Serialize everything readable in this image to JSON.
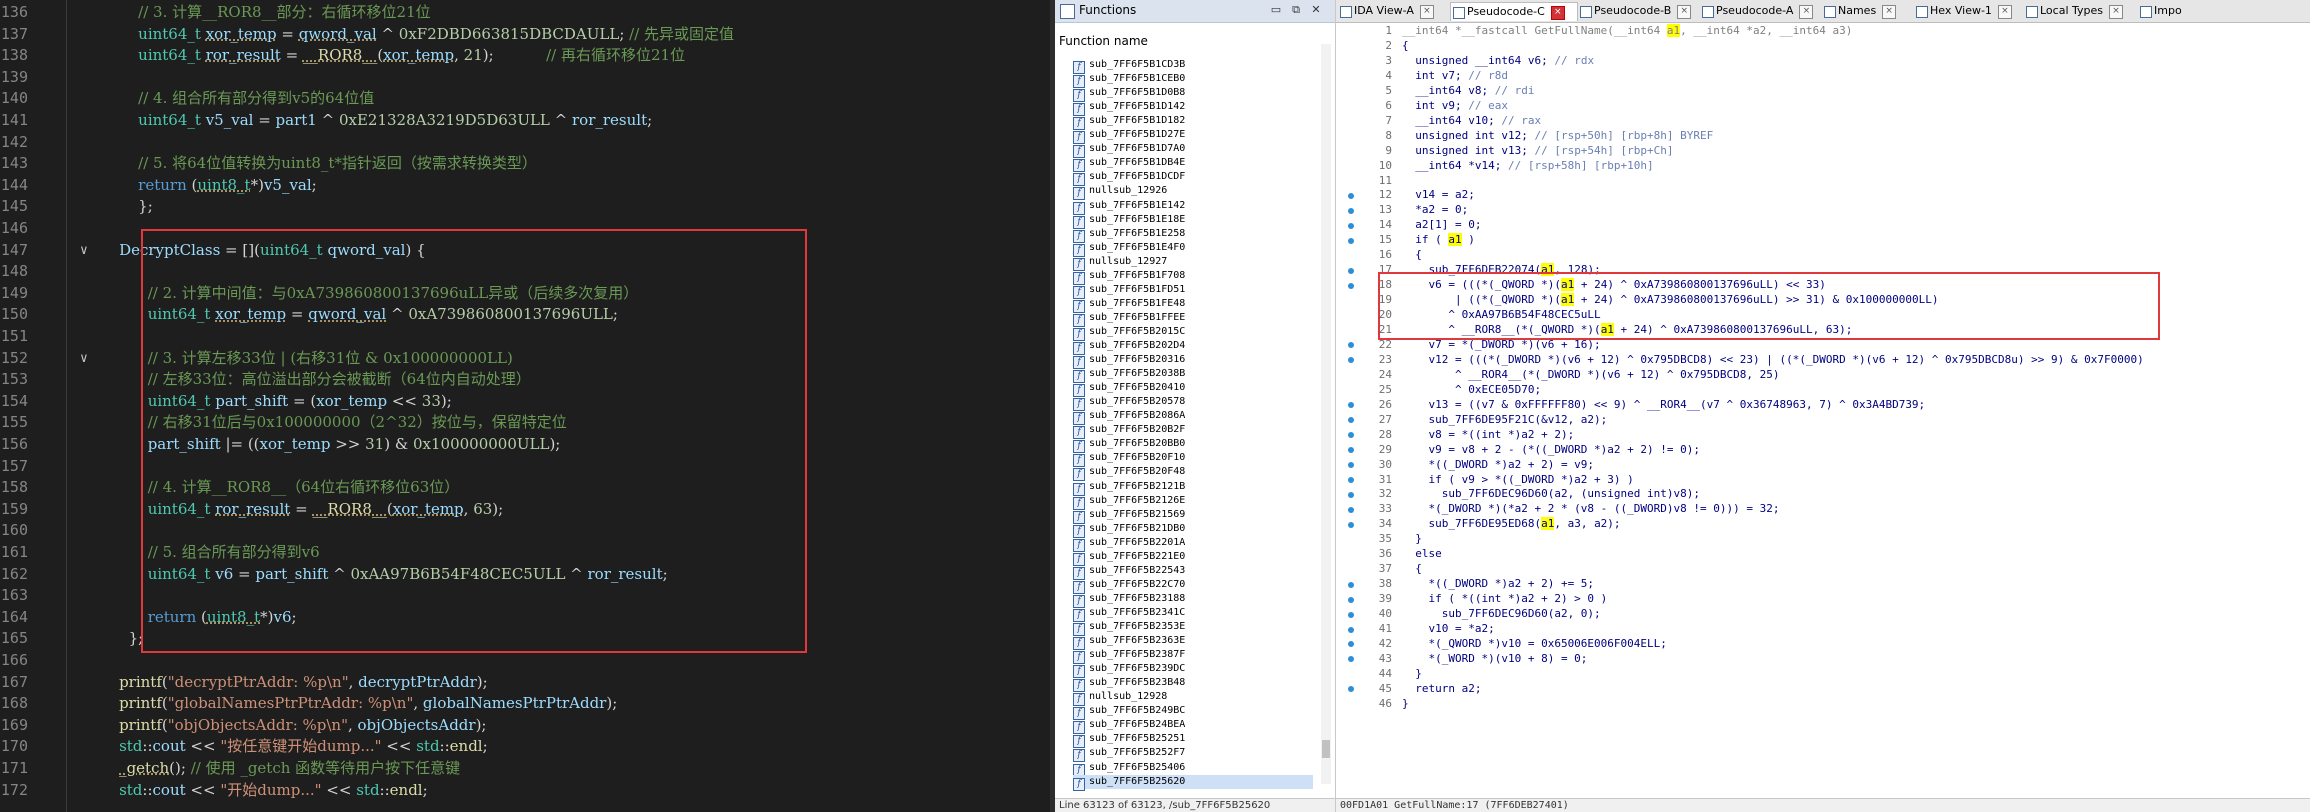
{
  "editor": {
    "lines": [
      {
        "n": "136",
        "html": "        <span class='cmt'>// 3. 计算__ROR8__部分：右循环移位21位</span>"
      },
      {
        "n": "137",
        "html": "        <span class='ty'>uint64_t</span> <span class='id sq'>xor_temp</span> = <span class='id sq'>qword_val</span> ^ <span class='num'>0xF2DBD663815DBCDAULL</span>; <span class='cmt'>// 先异或固定值</span>"
      },
      {
        "n": "138",
        "html": "        <span class='ty'>uint64_t</span> <span class='id sq'>ror_result</span> = <span class='fn sq'>__ROR8__</span>(<span class='id sq'>xor_temp</span>, <span class='num'>21</span>);           <span class='cmt'>// 再右循环移位21位</span>"
      },
      {
        "n": "139",
        "html": ""
      },
      {
        "n": "140",
        "html": "        <span class='cmt'>// 4. 组合所有部分得到v5的64位值</span>"
      },
      {
        "n": "141",
        "html": "        <span class='ty'>uint64_t</span> <span class='id'>v5_val</span> = <span class='id'>part1</span> ^ <span class='num'>0xE21328A3219D5D63ULL</span> ^ <span class='id'>ror_result</span>;"
      },
      {
        "n": "142",
        "html": ""
      },
      {
        "n": "143",
        "html": "        <span class='cmt'>// 5. 将64位值转换为uint8_t*指针返回（按需求转换类型）</span>"
      },
      {
        "n": "144",
        "html": "        <span class='kw'>return</span> (<span class='ty sq'>uint8_t</span>*)<span class='id'>v5_val</span>;"
      },
      {
        "n": "145",
        "html": "        };"
      },
      {
        "n": "146",
        "html": ""
      },
      {
        "n": "147",
        "html": "    <span class='id'>DecryptClass</span> = [](<span class='ty'>uint64_t</span> <span class='id'>qword_val</span>) {"
      },
      {
        "n": "148",
        "html": ""
      },
      {
        "n": "149",
        "html": "          <span class='cmt'>// 2. 计算中间值：与0xA739860800137696uLL异或（后续多次复用）</span>"
      },
      {
        "n": "150",
        "html": "          <span class='ty'>uint64_t</span> <span class='id sq'>xor_temp</span> = <span class='id sq'>qword_val</span> ^ <span class='num'>0xA739860800137696ULL</span>;"
      },
      {
        "n": "151",
        "html": ""
      },
      {
        "n": "152",
        "html": "          <span class='cmt'>// 3. 计算左移33位 | (右移31位 &amp; 0x100000000LL)</span>"
      },
      {
        "n": "153",
        "html": "          <span class='cmt'>// 左移33位：高位溢出部分会被截断（64位内自动处理）</span>"
      },
      {
        "n": "154",
        "html": "          <span class='ty'>uint64_t</span> <span class='id'>part_shift</span> = (<span class='id'>xor_temp</span> &lt;&lt; <span class='num'>33</span>);"
      },
      {
        "n": "155",
        "html": "          <span class='cmt'>// 右移31位后与0x100000000（2^32）按位与，保留特定位</span>"
      },
      {
        "n": "156",
        "html": "          <span class='id'>part_shift</span> |= ((<span class='id'>xor_temp</span> &gt;&gt; <span class='num'>31</span>) &amp; <span class='num'>0x100000000ULL</span>);"
      },
      {
        "n": "157",
        "html": ""
      },
      {
        "n": "158",
        "html": "          <span class='cmt'>// 4. 计算__ROR8__（64位右循环移位63位）</span>"
      },
      {
        "n": "159",
        "html": "          <span class='ty'>uint64_t</span> <span class='id sq'>ror_result</span> = <span class='fn sq'>__ROR8__</span>(<span class='id sq'>xor_temp</span>, <span class='num'>63</span>);"
      },
      {
        "n": "160",
        "html": ""
      },
      {
        "n": "161",
        "html": "          <span class='cmt'>// 5. 组合所有部分得到v6</span>"
      },
      {
        "n": "162",
        "html": "          <span class='ty'>uint64_t</span> <span class='id'>v6</span> = <span class='id'>part_shift</span> ^ <span class='num'>0xAA97B6B54F48CEC5ULL</span> ^ <span class='id'>ror_result</span>;"
      },
      {
        "n": "163",
        "html": ""
      },
      {
        "n": "164",
        "html": "          <span class='kw'>return</span> (<span class='ty sq'>uint8_t</span>*)<span class='id'>v6</span>;"
      },
      {
        "n": "165",
        "html": "      };"
      },
      {
        "n": "166",
        "html": ""
      },
      {
        "n": "167",
        "html": "    <span class='fn'>printf</span>(<span class='str'>\"decryptPtrAddr: %p\\n\"</span>, <span class='id'>decryptPtrAddr</span>);"
      },
      {
        "n": "168",
        "html": "    <span class='fn'>printf</span>(<span class='str'>\"globalNamesPtrPtrAddr: %p\\n\"</span>, <span class='id'>globalNamesPtrPtrAddr</span>);"
      },
      {
        "n": "169",
        "html": "    <span class='fn'>printf</span>(<span class='str'>\"objObjectsAddr: %p\\n\"</span>, <span class='id'>objObjectsAddr</span>);"
      },
      {
        "n": "170",
        "html": "    <span class='ty'>std</span>::<span class='id'>cout</span> &lt;&lt; <span class='str'>\"按任意键开始dump...\"</span> &lt;&lt; <span class='ty'>std</span>::<span class='fn'>endl</span>;"
      },
      {
        "n": "171",
        "html": "    <span class='fn sq'>_getch</span>(); <span class='cmt'>// 使用 _getch 函数等待用户按下任意键</span>"
      },
      {
        "n": "172",
        "html": "    <span class='ty'>std</span>::<span class='id'>cout</span> &lt;&lt; <span class='str'>\"开始dump...\"</span> &lt;&lt; <span class='ty'>std</span>::<span class='fn'>endl</span>;"
      }
    ]
  },
  "functions": {
    "title": "Functions",
    "column_header": "Function name",
    "items": [
      "sub_7FF6F5B1CD3B",
      "sub_7FF6F5B1CEB0",
      "sub_7FF6F5B1D0B8",
      "sub_7FF6F5B1D142",
      "sub_7FF6F5B1D182",
      "sub_7FF6F5B1D27E",
      "sub_7FF6F5B1D7A0",
      "sub_7FF6F5B1DB4E",
      "sub_7FF6F5B1DCDF",
      "nullsub_12926",
      "sub_7FF6F5B1E142",
      "sub_7FF6F5B1E18E",
      "sub_7FF6F5B1E258",
      "sub_7FF6F5B1E4F0",
      "nullsub_12927",
      "sub_7FF6F5B1F708",
      "sub_7FF6F5B1FD51",
      "sub_7FF6F5B1FE48",
      "sub_7FF6F5B1FFEE",
      "sub_7FF6F5B2015C",
      "sub_7FF6F5B202D4",
      "sub_7FF6F5B20316",
      "sub_7FF6F5B2038B",
      "sub_7FF6F5B20410",
      "sub_7FF6F5B20578",
      "sub_7FF6F5B2086A",
      "sub_7FF6F5B20B2F",
      "sub_7FF6F5B20BB0",
      "sub_7FF6F5B20F10",
      "sub_7FF6F5B20F48",
      "sub_7FF6F5B2121B",
      "sub_7FF6F5B2126E",
      "sub_7FF6F5B21569",
      "sub_7FF6F5B21DB0",
      "sub_7FF6F5B2201A",
      "sub_7FF6F5B221E0",
      "sub_7FF6F5B22543",
      "sub_7FF6F5B22C70",
      "sub_7FF6F5B23188",
      "sub_7FF6F5B2341C",
      "sub_7FF6F5B2353E",
      "sub_7FF6F5B2363E",
      "sub_7FF6F5B2387F",
      "sub_7FF6F5B239DC",
      "sub_7FF6F5B23B48",
      "nullsub_12928",
      "sub_7FF6F5B249BC",
      "sub_7FF6F5B24BEA",
      "sub_7FF6F5B25251",
      "sub_7FF6F5B252F7",
      "sub_7FF6F5B25406",
      "sub_7FF6F5B25620"
    ],
    "status": "Line 63123 of 63123, /sub_7FF6F5B25620"
  },
  "pseudo": {
    "tabs": [
      {
        "label": "IDA View-A",
        "close": "×",
        "active": false
      },
      {
        "label": "Pseudocode-C",
        "close": "×",
        "active": true
      },
      {
        "label": "Pseudocode-B",
        "close": "×",
        "active": false
      },
      {
        "label": "Pseudocode-A",
        "close": "×",
        "active": false
      },
      {
        "label": "Names",
        "close": "×",
        "active": false
      },
      {
        "label": "Hex View-1",
        "close": "×",
        "active": false
      },
      {
        "label": "Local Types",
        "close": "×",
        "active": false
      },
      {
        "label": "Impo",
        "close": "",
        "active": false
      }
    ],
    "lines": [
      {
        "n": "1",
        "dot": false,
        "html": "<span class='pgr'>__int64 *__fastcall GetFullName(__int64 <span class='hl'>a1</span>, __int64 *a2, __int64 a3)</span>"
      },
      {
        "n": "2",
        "dot": false,
        "html": "{"
      },
      {
        "n": "3",
        "dot": false,
        "html": "  unsigned __int64 v6; <span class='pcm'>// rdx</span>"
      },
      {
        "n": "4",
        "dot": false,
        "html": "  int v7; <span class='pcm'>// r8d</span>"
      },
      {
        "n": "5",
        "dot": false,
        "html": "  __int64 v8; <span class='pcm'>// rdi</span>"
      },
      {
        "n": "6",
        "dot": false,
        "html": "  int v9; <span class='pcm'>// eax</span>"
      },
      {
        "n": "7",
        "dot": false,
        "html": "  __int64 v10; <span class='pcm'>// rax</span>"
      },
      {
        "n": "8",
        "dot": false,
        "html": "  unsigned int v12; <span class='pcm'>// [rsp+50h] [rbp+8h] BYREF</span>"
      },
      {
        "n": "9",
        "dot": false,
        "html": "  unsigned int v13; <span class='pcm'>// [rsp+54h] [rbp+Ch]</span>"
      },
      {
        "n": "10",
        "dot": false,
        "html": "  __int64 *v14; <span class='pcm'>// [rsp+58h] [rbp+10h]</span>"
      },
      {
        "n": "11",
        "dot": false,
        "html": ""
      },
      {
        "n": "12",
        "dot": true,
        "html": "  v14 = a2;"
      },
      {
        "n": "13",
        "dot": true,
        "html": "  *a2 = 0;"
      },
      {
        "n": "14",
        "dot": true,
        "html": "  a2[1] = 0;"
      },
      {
        "n": "15",
        "dot": true,
        "html": "  if ( <span class='hl'>a1</span> )"
      },
      {
        "n": "16",
        "dot": false,
        "html": "  {"
      },
      {
        "n": "17",
        "dot": true,
        "html": "    sub_7FF6DEB22074(<span class='hl'>a1</span>, 128);"
      },
      {
        "n": "18",
        "dot": true,
        "html": "    v6 = (((*(_QWORD *)(<span class='hl'>a1</span> + 24) ^ 0xA739860800137696uLL) &lt;&lt; 33)"
      },
      {
        "n": "19",
        "dot": false,
        "html": "        | ((*(_QWORD *)(<span class='hl'>a1</span> + 24) ^ 0xA739860800137696uLL) &gt;&gt; 31) &amp; 0x100000000LL)"
      },
      {
        "n": "20",
        "dot": false,
        "html": "       ^ 0xAA97B6B54F48CEC5uLL"
      },
      {
        "n": "21",
        "dot": false,
        "html": "       ^ __ROR8__(*(_QWORD *)(<span class='hl'>a1</span> + 24) ^ 0xA739860800137696uLL, 63);"
      },
      {
        "n": "22",
        "dot": true,
        "html": "    v7 = *(_DWORD *)(v6 + 16);"
      },
      {
        "n": "23",
        "dot": true,
        "html": "    v12 = (((*(_DWORD *)(v6 + 12) ^ 0x795DBCD8) &lt;&lt; 23) | ((*(_DWORD *)(v6 + 12) ^ 0x795DBCD8u) &gt;&gt; 9) &amp; 0x7F0000)"
      },
      {
        "n": "24",
        "dot": false,
        "html": "        ^ __ROR4__(*(_DWORD *)(v6 + 12) ^ 0x795DBCD8, 25)"
      },
      {
        "n": "25",
        "dot": false,
        "html": "        ^ 0xECE05D70;"
      },
      {
        "n": "26",
        "dot": true,
        "html": "    v13 = ((v7 &amp; 0xFFFFFF80) &lt;&lt; 9) ^ __ROR4__(v7 ^ 0x36748963, 7) ^ 0x3A4BD739;"
      },
      {
        "n": "27",
        "dot": true,
        "html": "    sub_7FF6DE95F21C(&amp;v12, a2);"
      },
      {
        "n": "28",
        "dot": true,
        "html": "    v8 = *((int *)a2 + 2);"
      },
      {
        "n": "29",
        "dot": true,
        "html": "    v9 = v8 + 2 - (*((_DWORD *)a2 + 2) != 0);"
      },
      {
        "n": "30",
        "dot": true,
        "html": "    *((_DWORD *)a2 + 2) = v9;"
      },
      {
        "n": "31",
        "dot": true,
        "html": "    if ( v9 &gt; *((_DWORD *)a2 + 3) )"
      },
      {
        "n": "32",
        "dot": true,
        "html": "      sub_7FF6DEC96D60(a2, (unsigned int)v8);"
      },
      {
        "n": "33",
        "dot": true,
        "html": "    *(_DWORD *)(*a2 + 2 * (v8 - ((_DWORD)v8 != 0))) = 32;"
      },
      {
        "n": "34",
        "dot": true,
        "html": "    sub_7FF6DE95ED68(<span class='hl'>a1</span>, a3, a2);"
      },
      {
        "n": "35",
        "dot": false,
        "html": "  }"
      },
      {
        "n": "36",
        "dot": false,
        "html": "  else"
      },
      {
        "n": "37",
        "dot": false,
        "html": "  {"
      },
      {
        "n": "38",
        "dot": true,
        "html": "    *((_DWORD *)a2 + 2) += 5;"
      },
      {
        "n": "39",
        "dot": true,
        "html": "    if ( *((int *)a2 + 2) &gt; 0 )"
      },
      {
        "n": "40",
        "dot": true,
        "html": "      sub_7FF6DEC96D60(a2, 0);"
      },
      {
        "n": "41",
        "dot": true,
        "html": "    v10 = *a2;"
      },
      {
        "n": "42",
        "dot": true,
        "html": "    *(_QWORD *)v10 = 0x65006E006F004ELL;"
      },
      {
        "n": "43",
        "dot": true,
        "html": "    *(_WORD *)(v10 + 8) = 0;"
      },
      {
        "n": "44",
        "dot": false,
        "html": "  }"
      },
      {
        "n": "45",
        "dot": true,
        "html": "  return a2;"
      },
      {
        "n": "46",
        "dot": false,
        "html": "}"
      }
    ],
    "status": "00FD1A01 GetFullName:17 (7FF6DEB27401)"
  }
}
